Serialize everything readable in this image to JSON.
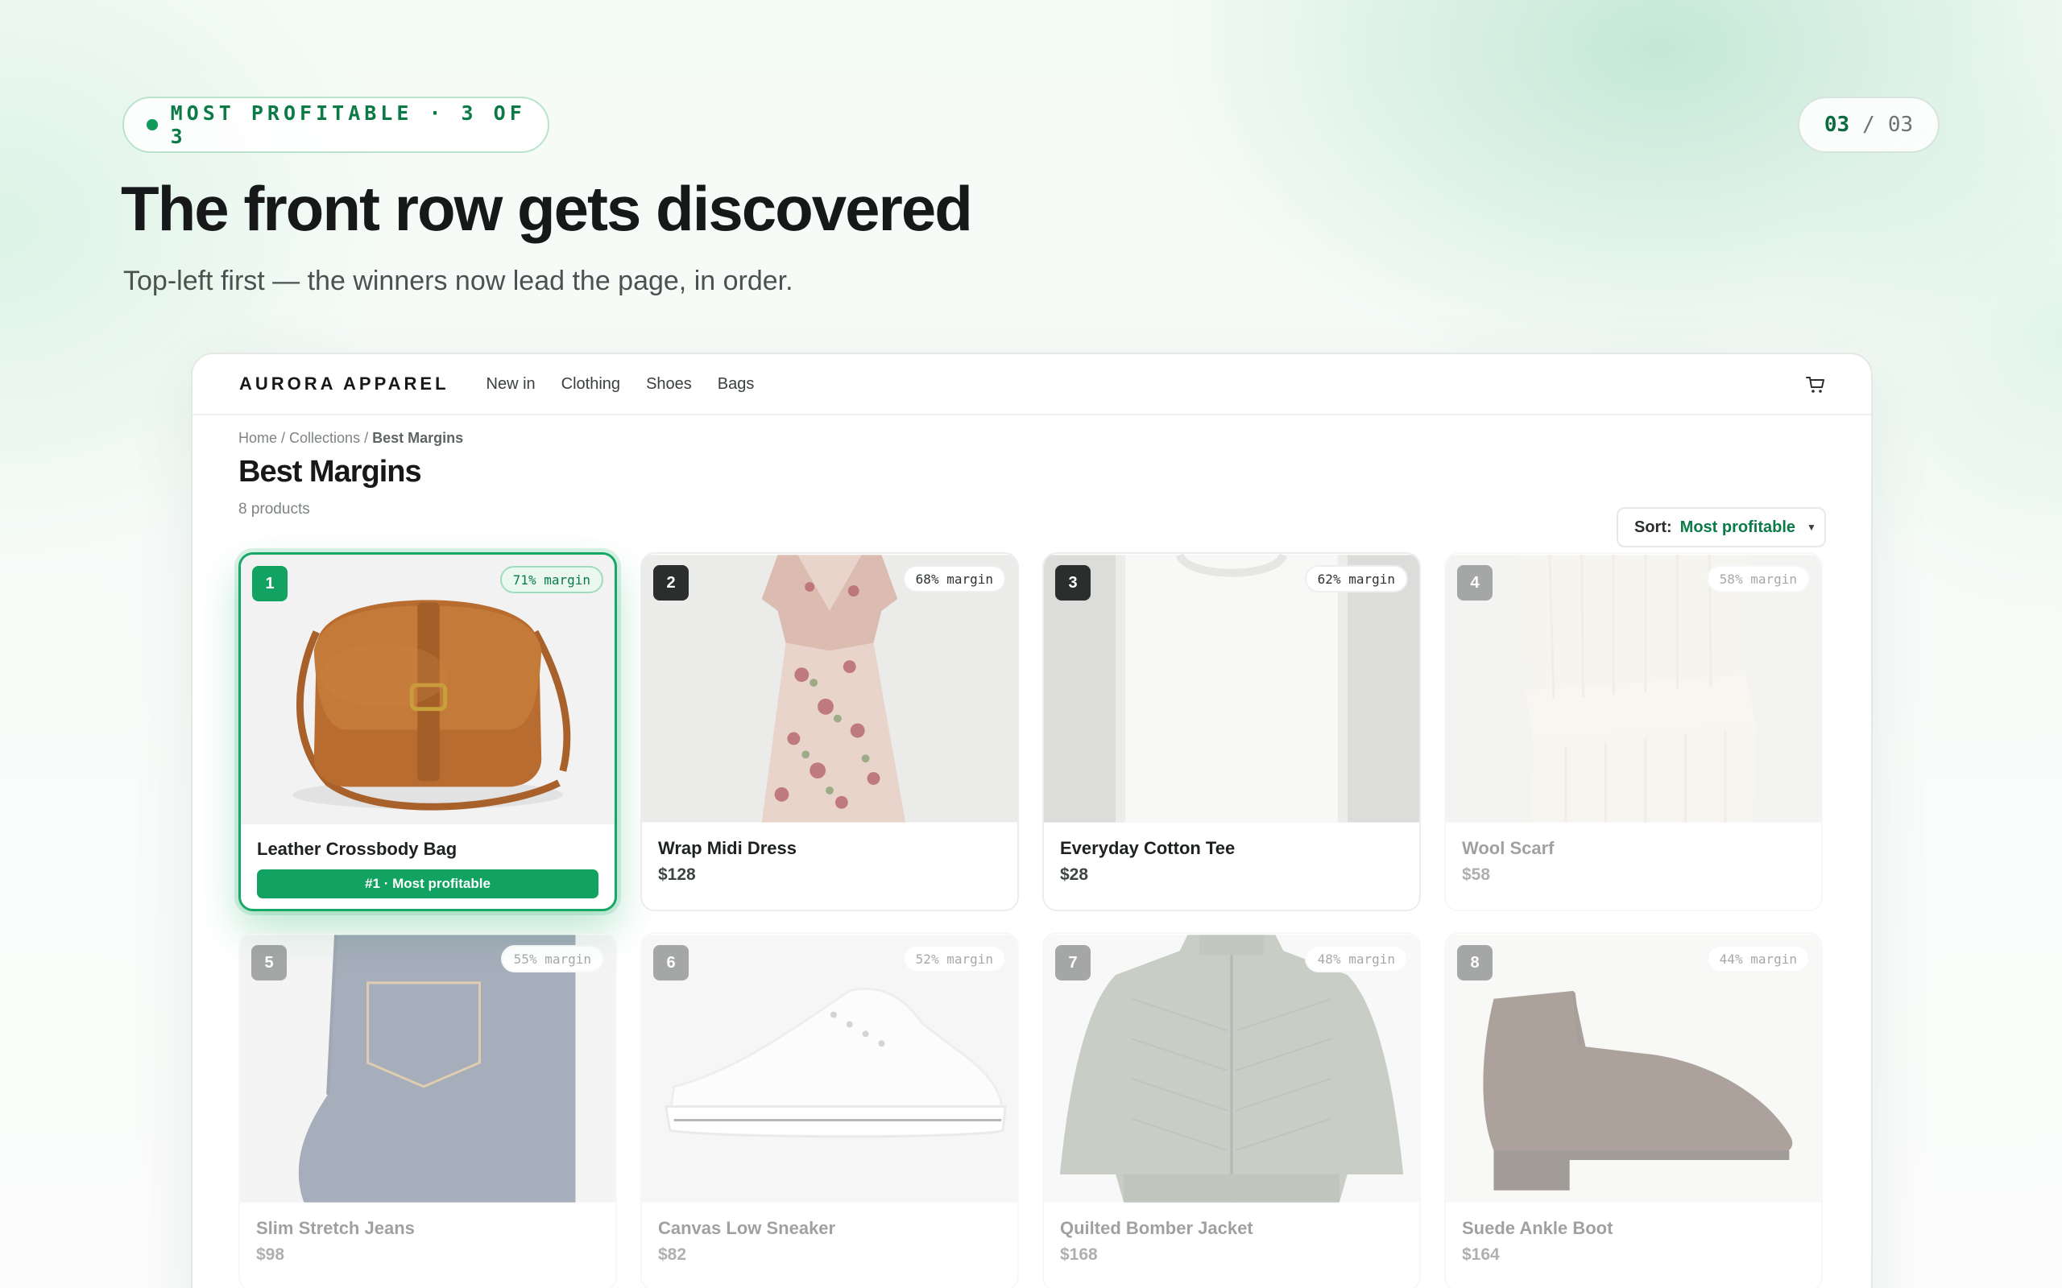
{
  "slide": {
    "eyebrow": "MOST PROFITABLE · 3 OF 3",
    "counter_current": "03",
    "counter_separator": "/",
    "counter_total": "03",
    "headline": "The front row gets discovered",
    "subtitle": "Top-left first — the winners now lead the page, in order."
  },
  "shop": {
    "brand": "AURORA APPAREL",
    "nav": [
      "New in",
      "Clothing",
      "Shoes",
      "Bags"
    ],
    "cart_icon": "cart-icon",
    "breadcrumb": {
      "home": "Home",
      "sep1": " / ",
      "collections": "Collections",
      "sep2": " / ",
      "current": "Best Margins"
    },
    "title": "Best Margins",
    "count": "8 products",
    "sort_label": "Sort:",
    "sort_value": "Most profitable"
  },
  "products": [
    {
      "rank": "1",
      "margin": "71% margin",
      "name": "Leather Crossbody Bag",
      "cta": "#1 · Most profitable",
      "state": "winner"
    },
    {
      "rank": "2",
      "margin": "68% margin",
      "name": "Wrap Midi Dress",
      "price": "$128",
      "state": "top"
    },
    {
      "rank": "3",
      "margin": "62% margin",
      "name": "Everyday Cotton Tee",
      "price": "$28",
      "state": "top"
    },
    {
      "rank": "4",
      "margin": "58% margin",
      "name": "Wool Scarf",
      "price": "$58",
      "state": "dim"
    },
    {
      "rank": "5",
      "margin": "55% margin",
      "name": "Slim Stretch Jeans",
      "price": "$98",
      "state": "dim"
    },
    {
      "rank": "6",
      "margin": "52% margin",
      "name": "Canvas Low Sneaker",
      "price": "$82",
      "state": "dim"
    },
    {
      "rank": "7",
      "margin": "48% margin",
      "name": "Quilted Bomber Jacket",
      "price": "$168",
      "state": "dim"
    },
    {
      "rank": "8",
      "margin": "44% margin",
      "name": "Suede Ankle Boot",
      "price": "$164",
      "state": "dim"
    }
  ],
  "colors": {
    "accent": "#12a262",
    "accent_dark": "#0b7a47",
    "text": "#16181a"
  }
}
